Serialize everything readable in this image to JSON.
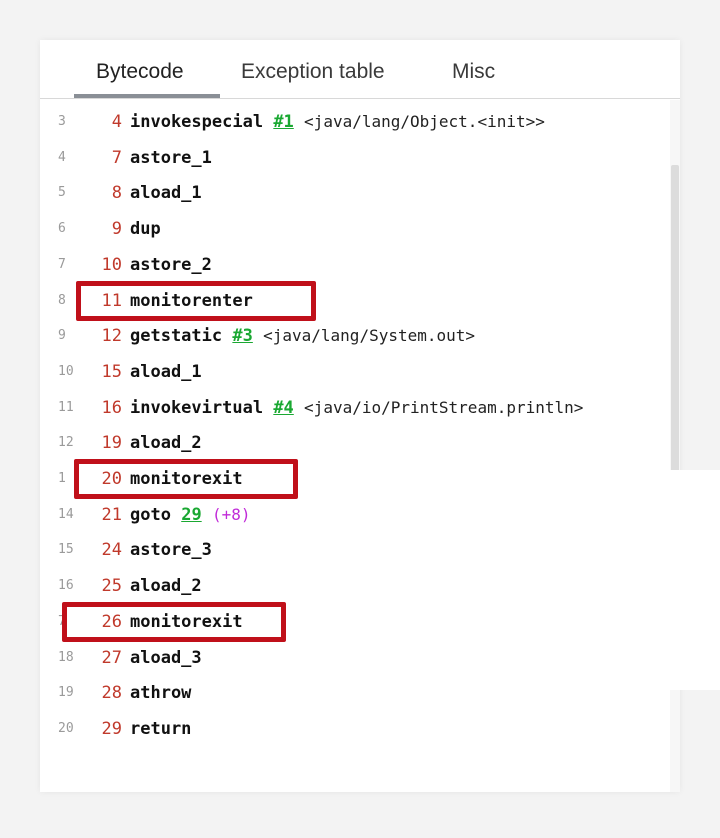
{
  "tabs": [
    {
      "label": "Bytecode",
      "active": true
    },
    {
      "label": "Exception table",
      "active": false
    },
    {
      "label": "Misc",
      "active": false
    }
  ],
  "colors": {
    "offset": "#c0392b",
    "reference_link": "#1aa832",
    "relative_jump": "#c02bd8",
    "highlight_box": "#c0101a"
  },
  "lines": [
    {
      "ln": "3",
      "off": "4",
      "op": "invokespecial",
      "ref": "#1",
      "arg": "<java/lang/Object.<init>>",
      "rel": ""
    },
    {
      "ln": "4",
      "off": "7",
      "op": "astore_1",
      "ref": "",
      "arg": "",
      "rel": ""
    },
    {
      "ln": "5",
      "off": "8",
      "op": "aload_1",
      "ref": "",
      "arg": "",
      "rel": ""
    },
    {
      "ln": "6",
      "off": "9",
      "op": "dup",
      "ref": "",
      "arg": "",
      "rel": ""
    },
    {
      "ln": "7",
      "off": "10",
      "op": "astore_2",
      "ref": "",
      "arg": "",
      "rel": ""
    },
    {
      "ln": "8",
      "off": "11",
      "op": "monitorenter",
      "ref": "",
      "arg": "",
      "rel": "",
      "highlight": true
    },
    {
      "ln": "9",
      "off": "12",
      "op": "getstatic",
      "ref": "#3",
      "arg": "<java/lang/System.out>",
      "rel": ""
    },
    {
      "ln": "10",
      "off": "15",
      "op": "aload_1",
      "ref": "",
      "arg": "",
      "rel": ""
    },
    {
      "ln": "11",
      "off": "16",
      "op": "invokevirtual",
      "ref": "#4",
      "arg": "<java/io/PrintStream.println>",
      "rel": ""
    },
    {
      "ln": "12",
      "off": "19",
      "op": "aload_2",
      "ref": "",
      "arg": "",
      "rel": ""
    },
    {
      "ln": "1",
      "off": "20",
      "op": "monitorexit",
      "ref": "",
      "arg": "",
      "rel": "",
      "highlight": true
    },
    {
      "ln": "14",
      "off": "21",
      "op": "goto",
      "ref": "29",
      "arg": "",
      "rel": "(+8)"
    },
    {
      "ln": "15",
      "off": "24",
      "op": "astore_3",
      "ref": "",
      "arg": "",
      "rel": ""
    },
    {
      "ln": "16",
      "off": "25",
      "op": "aload_2",
      "ref": "",
      "arg": "",
      "rel": ""
    },
    {
      "ln": "7",
      "off": "26",
      "op": "monitorexit",
      "ref": "",
      "arg": "",
      "rel": "",
      "highlight": true
    },
    {
      "ln": "18",
      "off": "27",
      "op": "aload_3",
      "ref": "",
      "arg": "",
      "rel": ""
    },
    {
      "ln": "19",
      "off": "28",
      "op": "athrow",
      "ref": "",
      "arg": "",
      "rel": ""
    },
    {
      "ln": "20",
      "off": "29",
      "op": "return",
      "ref": "",
      "arg": "",
      "rel": ""
    }
  ]
}
